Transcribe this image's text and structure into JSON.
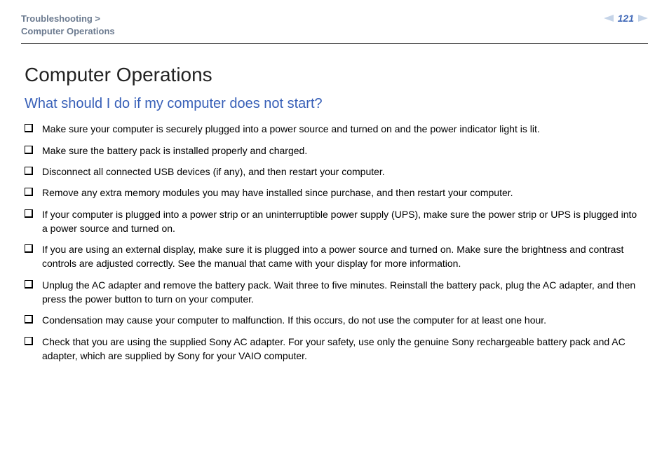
{
  "header": {
    "breadcrumb_line1": "Troubleshooting >",
    "breadcrumb_line2": "Computer Operations",
    "page_number": "121"
  },
  "content": {
    "title": "Computer Operations",
    "section_heading": "What should I do if my computer does not start?",
    "bullets": [
      "Make sure your computer is securely plugged into a power source and turned on and the power indicator light is lit.",
      "Make sure the battery pack is installed properly and charged.",
      "Disconnect all connected USB devices (if any), and then restart your computer.",
      "Remove any extra memory modules you may have installed since purchase, and then restart your computer.",
      "If your computer is plugged into a power strip or an uninterruptible power supply (UPS), make sure the power strip or UPS is plugged into a power source and turned on.",
      "If you are using an external display, make sure it is plugged into a power source and turned on. Make sure the brightness and contrast controls are adjusted correctly. See the manual that came with your display for more information.",
      "Unplug the AC adapter and remove the battery pack. Wait three to five minutes. Reinstall the battery pack, plug the AC adapter, and then press the power button to turn on your computer.",
      "Condensation may cause your computer to malfunction. If this occurs, do not use the computer for at least one hour.",
      "Check that you are using the supplied Sony AC adapter. For your safety, use only the genuine Sony rechargeable battery pack and AC adapter, which are supplied by Sony for your VAIO computer."
    ]
  }
}
